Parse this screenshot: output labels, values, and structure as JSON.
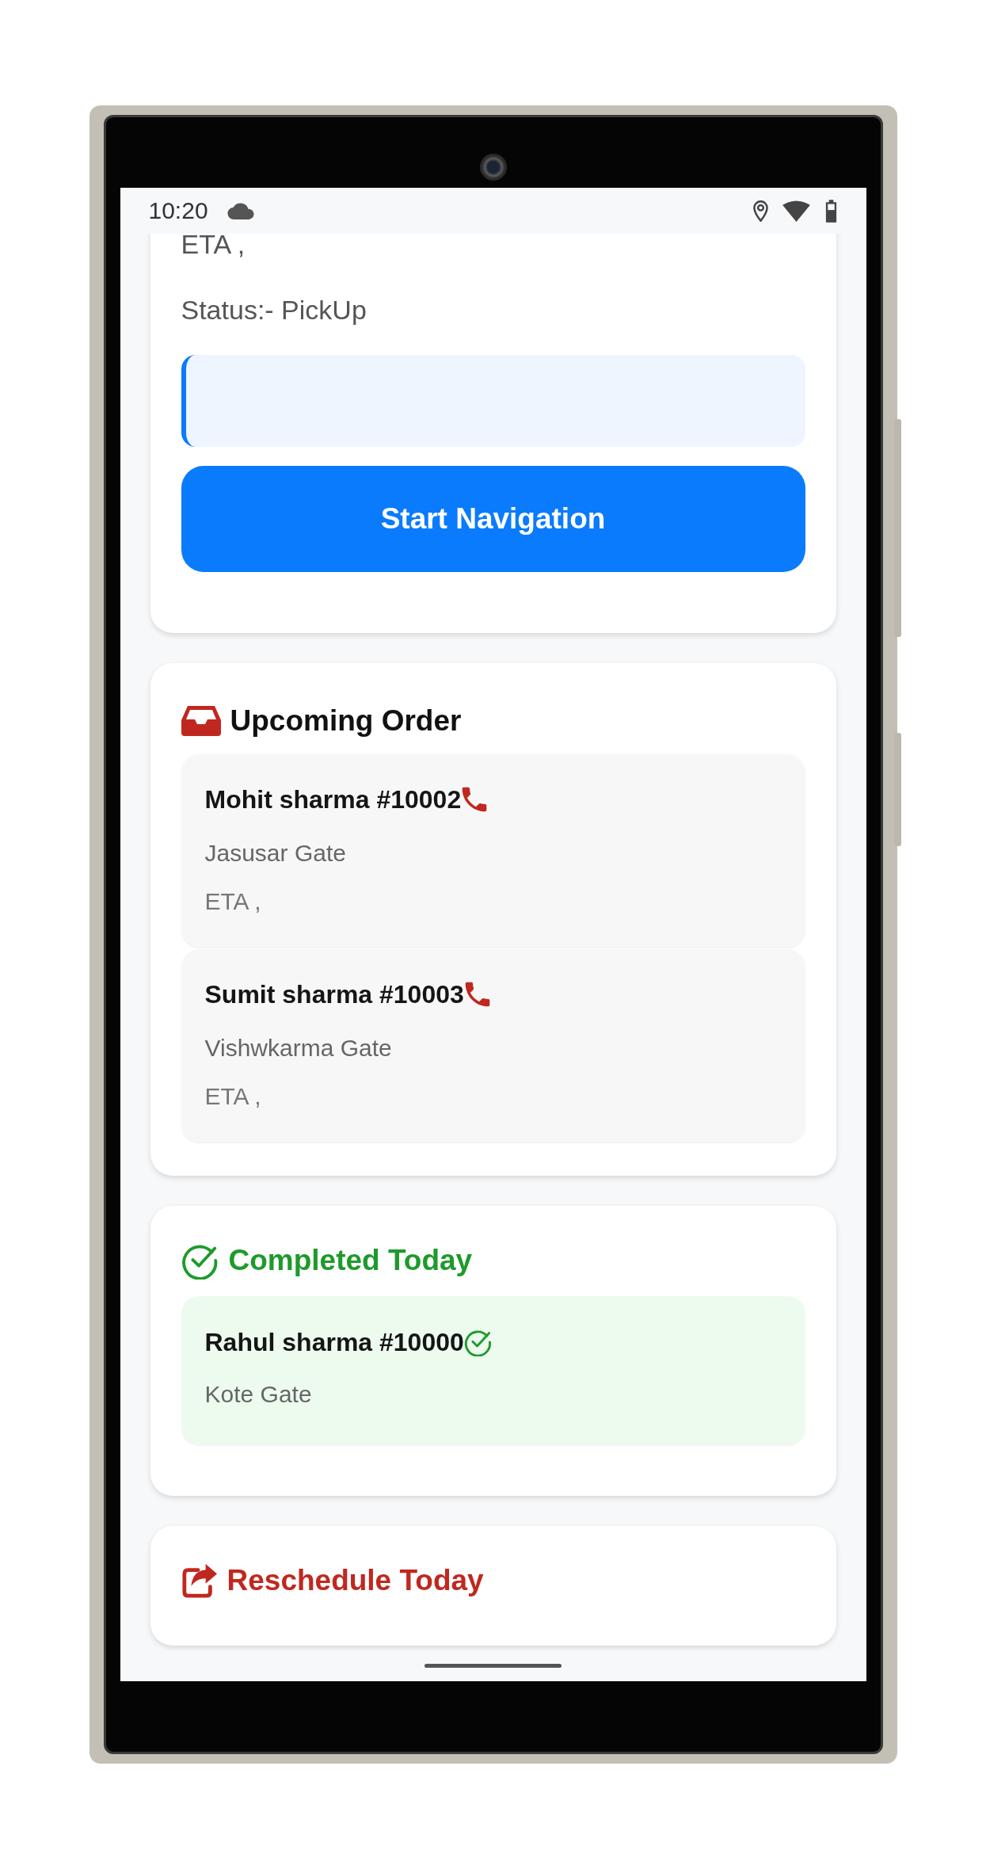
{
  "status_bar": {
    "time": "10:20"
  },
  "current_order": {
    "eta": "ETA ,",
    "status": "Status:- PickUp",
    "button": "Start Navigation"
  },
  "sections": [
    {
      "kind": "upcoming",
      "title": "Upcoming Order",
      "orders": [
        {
          "name": "Mohit sharma #10002",
          "address": "Jasusar Gate",
          "eta": "ETA ,"
        },
        {
          "name": "Sumit sharma #10003",
          "address": "Vishwkarma Gate",
          "eta": "ETA ,"
        }
      ]
    },
    {
      "kind": "completed",
      "title": "Completed Today",
      "orders": [
        {
          "name": "Rahul sharma #10000",
          "address": "Kote Gate"
        }
      ]
    },
    {
      "kind": "rescheduled",
      "title": "Reschedule Today"
    }
  ]
}
